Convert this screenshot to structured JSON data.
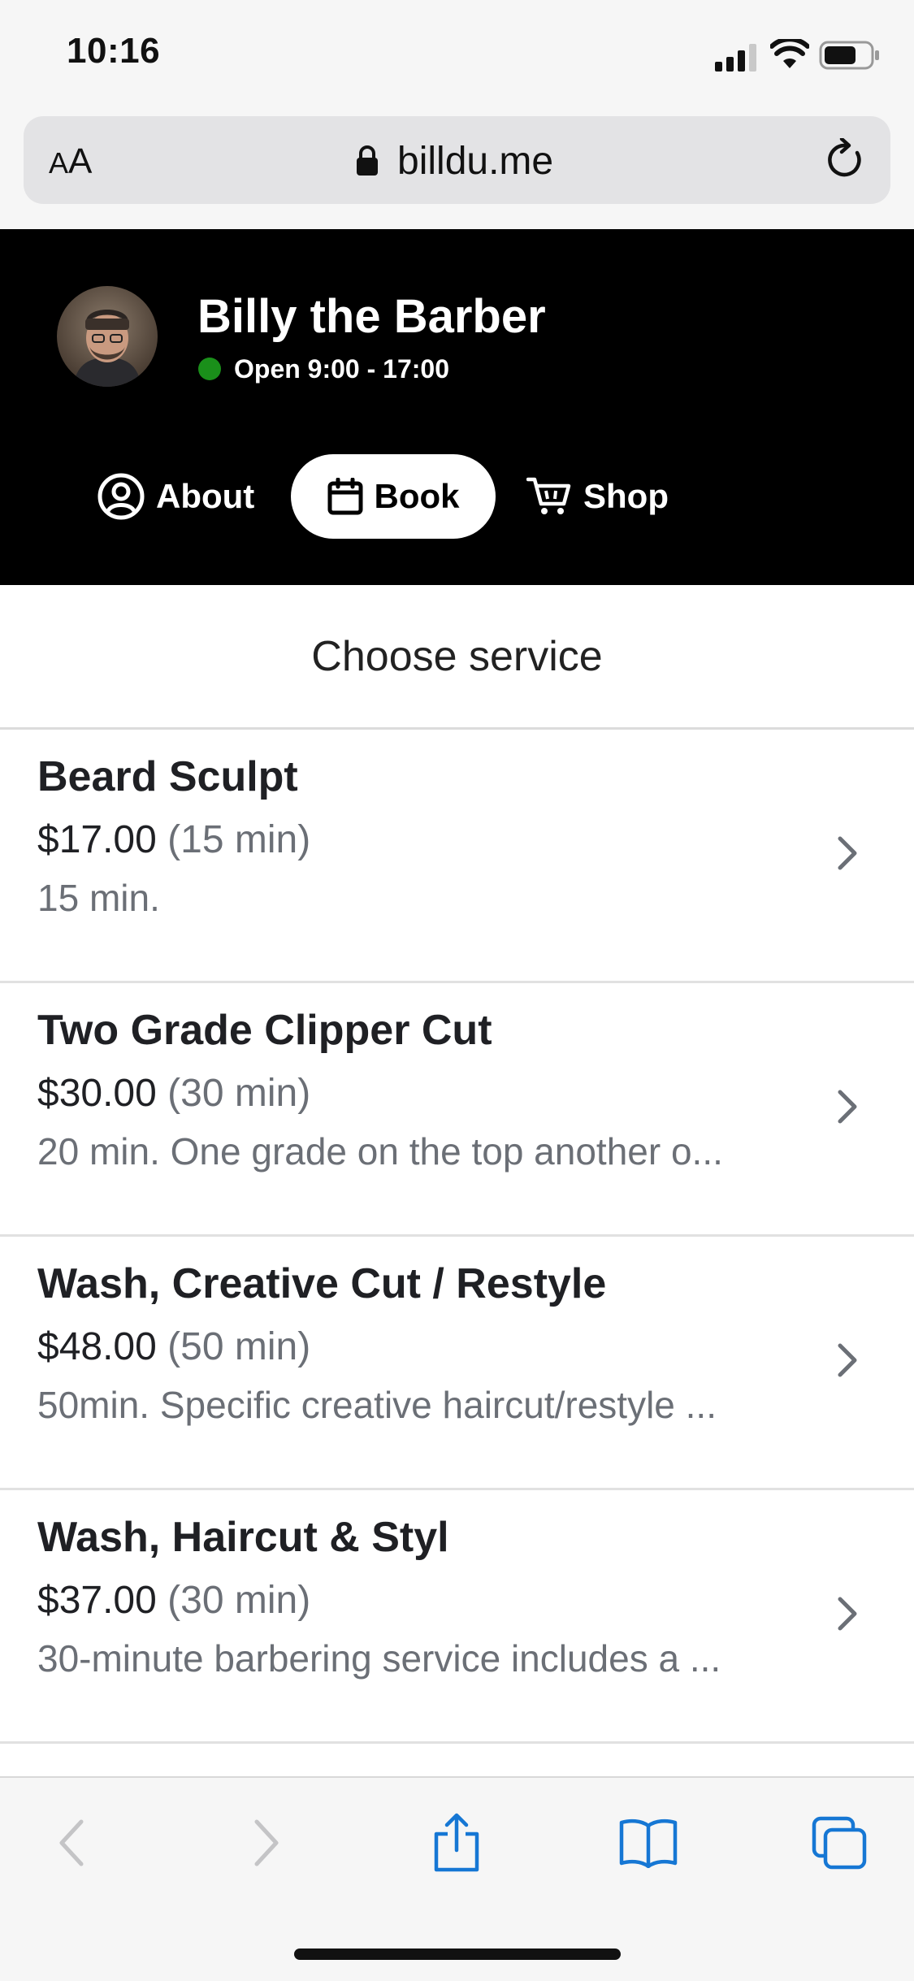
{
  "status_bar": {
    "time": "10:16"
  },
  "browser": {
    "text_size_small": "A",
    "text_size_large": "A",
    "url": "billdu.me"
  },
  "business": {
    "name": "Billy the Barber",
    "hours": "Open 9:00 - 17:00",
    "status_color": "#1a8f1a"
  },
  "nav": [
    {
      "label": "About",
      "icon": "user-circle-icon",
      "active": false
    },
    {
      "label": "Book",
      "icon": "calendar-icon",
      "active": true
    },
    {
      "label": "Shop",
      "icon": "cart-icon",
      "active": false
    }
  ],
  "section_title": "Choose service",
  "services": [
    {
      "name": "Beard Sculpt",
      "price": "$17.00",
      "duration": "(15 min)",
      "description": "15 min."
    },
    {
      "name": "Two Grade Clipper Cut",
      "price": "$30.00",
      "duration": "(30 min)",
      "description": "20 min. One grade on the top another o..."
    },
    {
      "name": "Wash, Creative Cut / Restyle",
      "price": "$48.00",
      "duration": "(50 min)",
      "description": "50min. Specific creative haircut/restyle ..."
    },
    {
      "name": "Wash, Haircut & Styl",
      "price": "$37.00",
      "duration": "(30 min)",
      "description": "30-minute barbering service includes a ..."
    }
  ],
  "colors": {
    "header_bg": "#000000",
    "accent_blue": "#1677d4"
  }
}
